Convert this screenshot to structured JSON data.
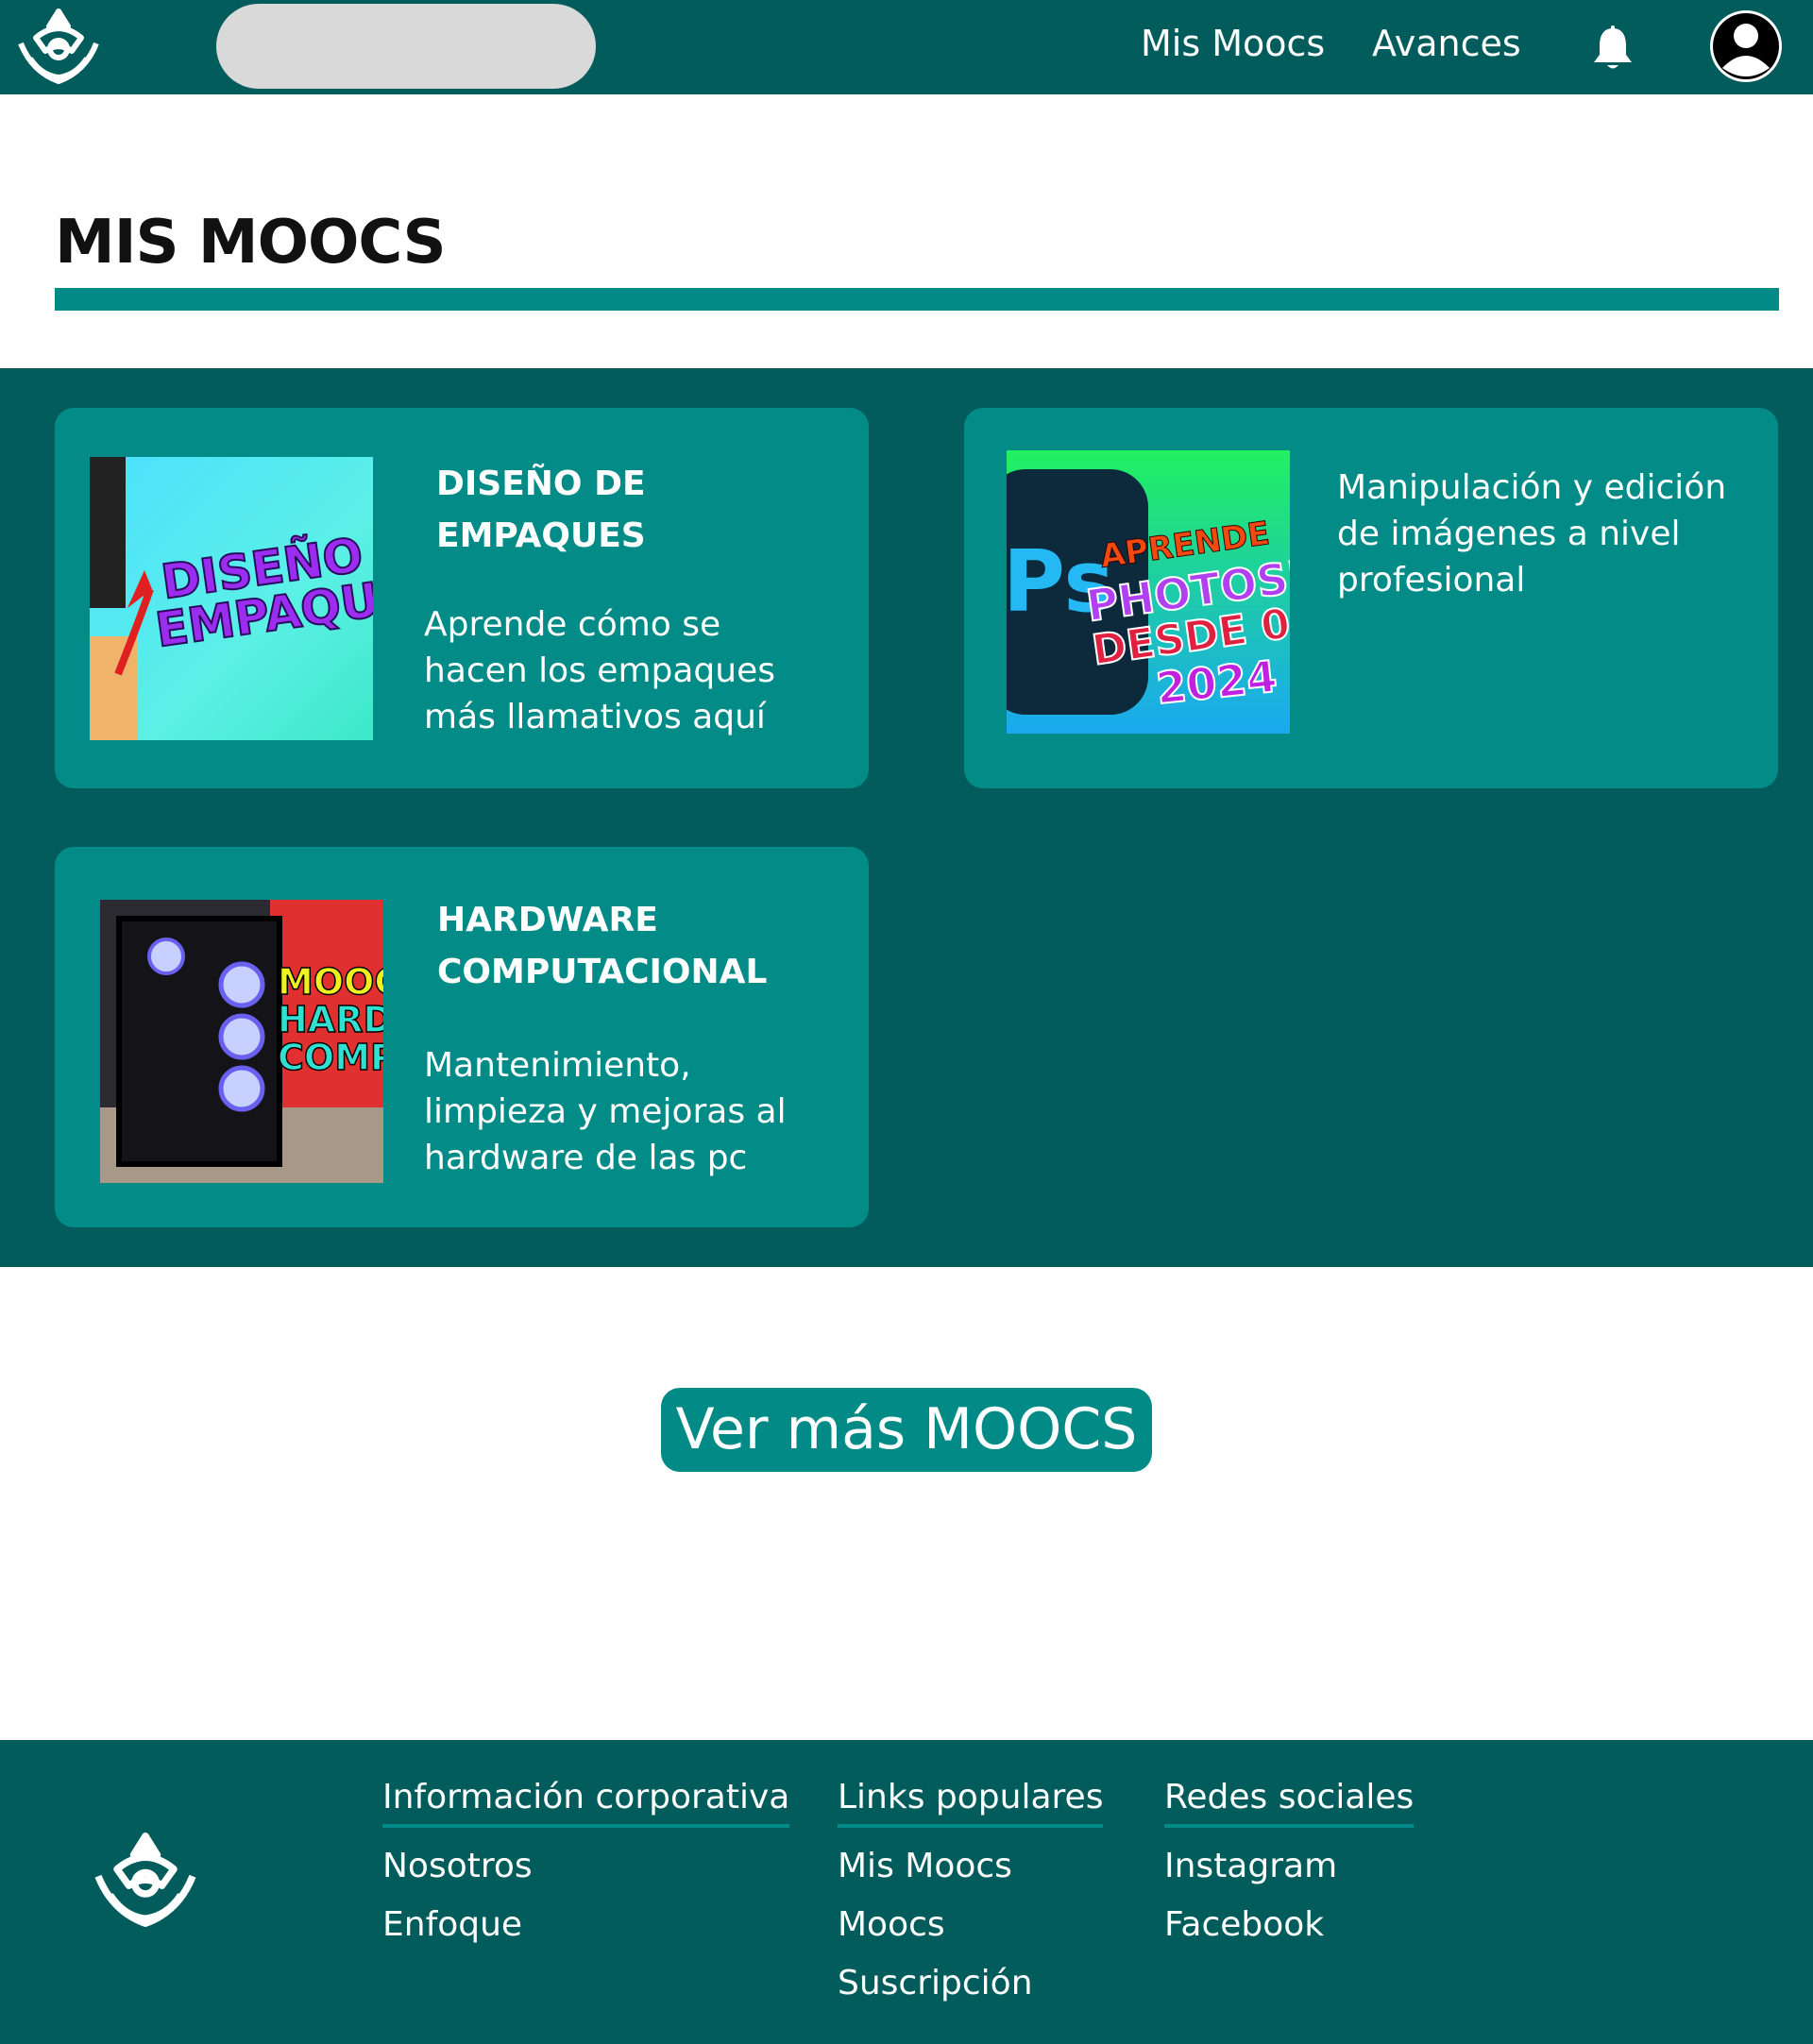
{
  "header": {
    "nav": [
      {
        "label": "Mis Moocs"
      },
      {
        "label": "Avances"
      }
    ]
  },
  "page": {
    "title": "MIS MOOCS"
  },
  "courses": [
    {
      "title": "DISEÑO DE EMPAQUES",
      "description": "Aprende cómo se hacen los empaques más llamativos aquí",
      "thumbnail_text": [
        "DISEÑO",
        "EMPAQU"
      ]
    },
    {
      "title": "",
      "description": "Manipulación y edición de imágenes a nivel profesional",
      "thumbnail_text": [
        "APRENDE",
        "PHOTOSH",
        "DESDE 0",
        "2024"
      ]
    },
    {
      "title": "HARDWARE COMPUTACIONAL",
      "description": "Mantenimiento, limpieza y mejoras al hardware de las pc",
      "thumbnail_text": [
        "MOOC",
        "HARDW",
        "COMP"
      ]
    }
  ],
  "more_button": {
    "label": "Ver más MOOCS"
  },
  "footer": {
    "columns": [
      {
        "heading": "Información corporativa",
        "links": [
          "Nosotros",
          "Enfoque"
        ]
      },
      {
        "heading": "Links populares",
        "links": [
          "Mis Moocs",
          "Moocs",
          "Suscripción"
        ]
      },
      {
        "heading": "Redes sociales",
        "links": [
          "Instagram",
          "Facebook"
        ]
      }
    ]
  },
  "colors": {
    "primary_dark": "#025c5c",
    "primary": "#028a86",
    "search_bg": "#d9d9d9"
  },
  "icons": [
    "logo-icon",
    "bell-icon",
    "user-avatar-icon"
  ]
}
